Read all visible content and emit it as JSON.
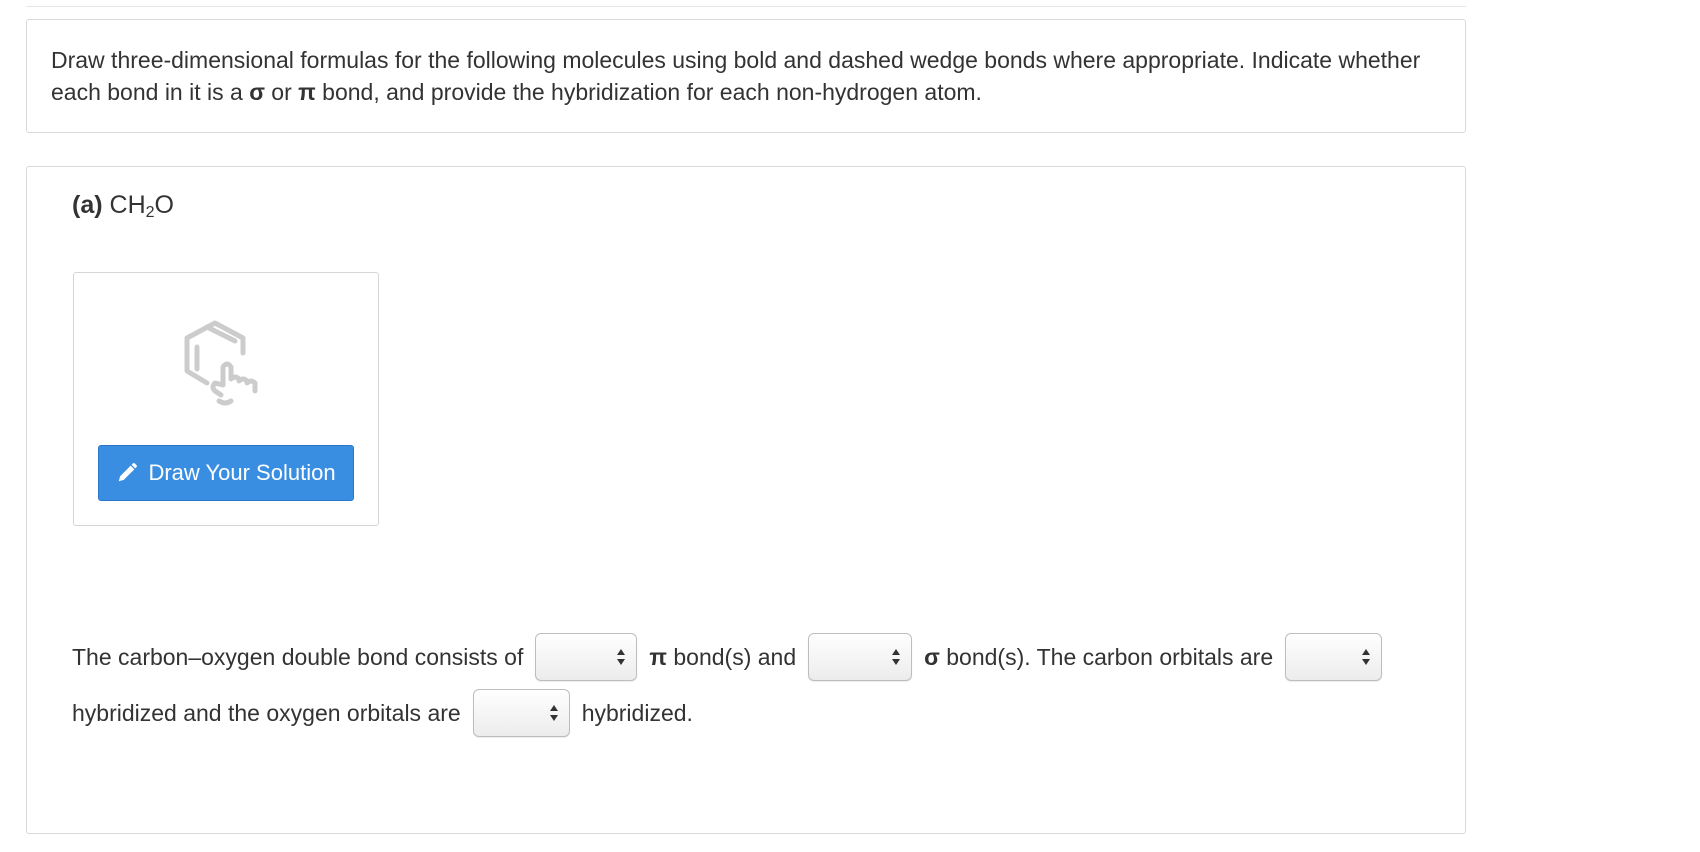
{
  "instructions": {
    "part1": "Draw three-dimensional formulas for the following molecules using bold and dashed wedge bonds where appropriate. Indicate whether each bond in it is a ",
    "sigma": "σ",
    "or": " or ",
    "pi": "π",
    "part2": " bond, and provide the hybridization for each non-hydrogen atom."
  },
  "part_a": {
    "label": "(a)",
    "formula_prefix": "CH",
    "formula_sub": "2",
    "formula_suffix": "O",
    "draw_button_label": "Draw Your Solution",
    "sentence": {
      "s1": "The carbon–oxygen double bond consists of",
      "pi": "π",
      "s2": " bond(s) and",
      "sigma": "σ",
      "s3": " bond(s). The carbon orbitals are",
      "s4": "hybridized and the oxygen orbitals are",
      "s5": "hybridized."
    },
    "selects": {
      "pi_count": "",
      "sigma_count": "",
      "carbon_hybridization": "",
      "oxygen_hybridization": ""
    }
  },
  "colors": {
    "button_bg": "#3a8ee2",
    "border": "#d9d9d9",
    "text": "#333333"
  },
  "icons": [
    "pencil-icon",
    "sketch-hand-icon",
    "select-arrows-icon"
  ]
}
